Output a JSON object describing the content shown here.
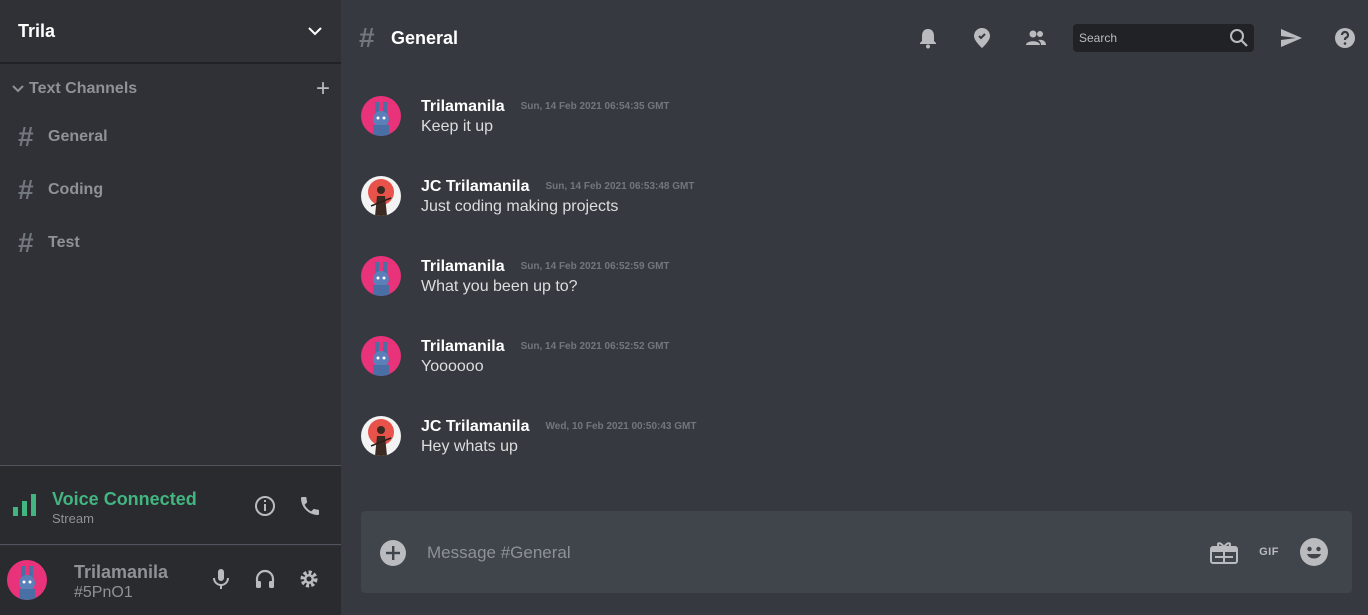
{
  "server": {
    "name": "Trila"
  },
  "category": {
    "label": "Text Channels"
  },
  "channels": [
    {
      "label": "General"
    },
    {
      "label": "Coding"
    },
    {
      "label": "Test"
    }
  ],
  "voice": {
    "status": "Voice Connected",
    "sub": "Stream"
  },
  "user": {
    "name": "Trilamanila",
    "tag": "#5PnO1"
  },
  "header": {
    "hash": "#",
    "title": "General"
  },
  "search": {
    "placeholder": "Search"
  },
  "messages": [
    {
      "author": "Trilamanila",
      "timestamp": "Sun, 14 Feb 2021 06:54:35 GMT",
      "text": "Keep it up",
      "avatar": "bunny"
    },
    {
      "author": "JC Trilamanila",
      "timestamp": "Sun, 14 Feb 2021 06:53:48 GMT",
      "text": "Just coding making projects",
      "avatar": "samurai"
    },
    {
      "author": "Trilamanila",
      "timestamp": "Sun, 14 Feb 2021 06:52:59 GMT",
      "text": "What you been up to?",
      "avatar": "bunny"
    },
    {
      "author": "Trilamanila",
      "timestamp": "Sun, 14 Feb 2021 06:52:52 GMT",
      "text": "Yoooooo",
      "avatar": "bunny"
    },
    {
      "author": "JC Trilamanila",
      "timestamp": "Wed, 10 Feb 2021 00:50:43 GMT",
      "text": "Hey whats up",
      "avatar": "samurai"
    }
  ],
  "composer": {
    "placeholder": "Message #General",
    "gif_label": "GIF"
  },
  "colors": {
    "online": "#43b581",
    "bunny_bg": "#e8337a",
    "samurai_bg": "#e8524a"
  }
}
